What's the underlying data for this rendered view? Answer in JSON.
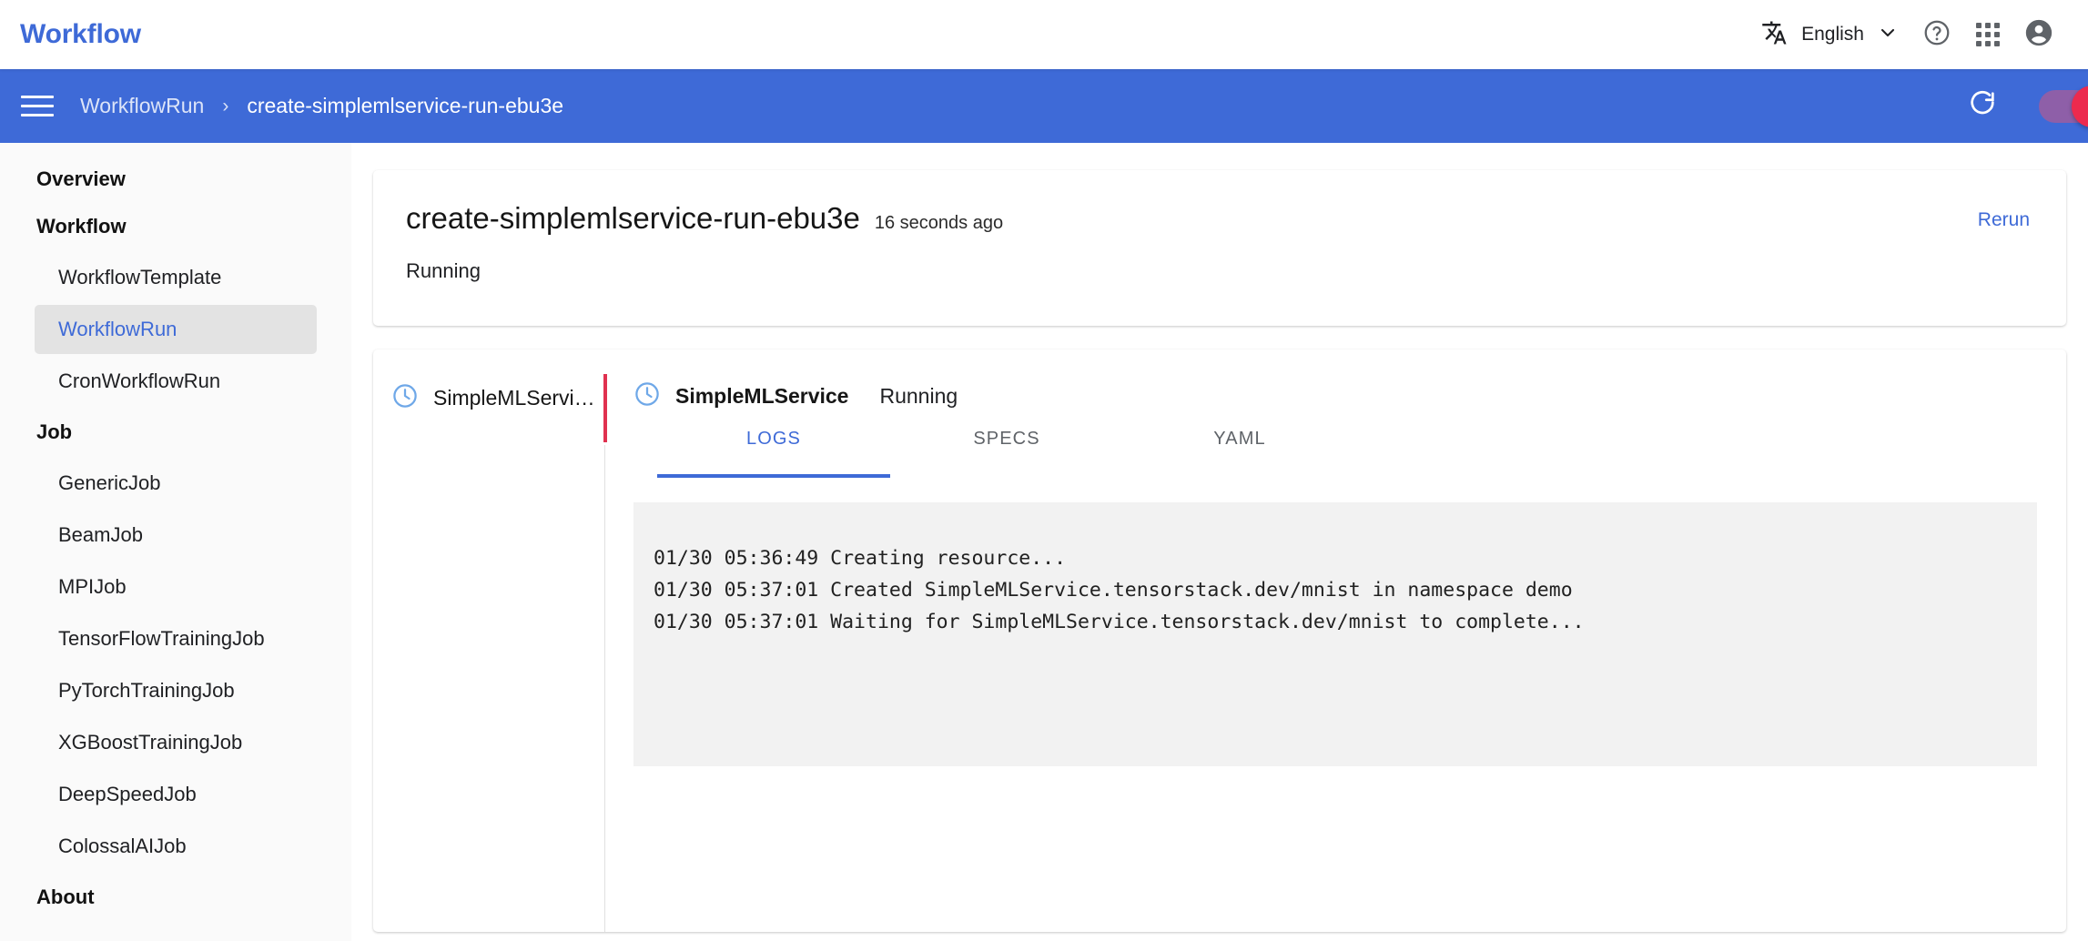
{
  "header": {
    "brand": "Workflow",
    "language": "English",
    "icons": {
      "translate": "translate-icon",
      "chevron": "chevron-down-icon",
      "help": "help-circle-icon",
      "apps": "apps-grid-icon",
      "account": "account-circle-icon"
    }
  },
  "appbar": {
    "menu_icon": "hamburger-menu-icon",
    "breadcrumb": {
      "parent": "WorkflowRun",
      "separator": "›",
      "current": "create-simplemlservice-run-ebu3e"
    },
    "refresh_icon": "refresh-icon",
    "auto_refresh_toggle": {
      "state": "on",
      "track_color": "#8E5FA8",
      "thumb_color": "#EC2A4E"
    }
  },
  "sidebar": {
    "items": [
      {
        "label": "Overview",
        "type": "head",
        "active": false
      },
      {
        "label": "Workflow",
        "type": "head",
        "active": false
      },
      {
        "label": "WorkflowTemplate",
        "type": "item",
        "active": false
      },
      {
        "label": "WorkflowRun",
        "type": "item",
        "active": true
      },
      {
        "label": "CronWorkflowRun",
        "type": "item",
        "active": false
      },
      {
        "label": "Job",
        "type": "head",
        "active": false
      },
      {
        "label": "GenericJob",
        "type": "item",
        "active": false
      },
      {
        "label": "BeamJob",
        "type": "item",
        "active": false
      },
      {
        "label": "MPIJob",
        "type": "item",
        "active": false
      },
      {
        "label": "TensorFlowTrainingJob",
        "type": "item",
        "active": false
      },
      {
        "label": "PyTorchTrainingJob",
        "type": "item",
        "active": false
      },
      {
        "label": "XGBoostTrainingJob",
        "type": "item",
        "active": false
      },
      {
        "label": "DeepSpeedJob",
        "type": "item",
        "active": false
      },
      {
        "label": "ColossalAIJob",
        "type": "item",
        "active": false
      },
      {
        "label": "About",
        "type": "head",
        "active": false
      }
    ]
  },
  "summary": {
    "title": "create-simplemlservice-run-ebu3e",
    "age": "16 seconds ago",
    "status": "Running",
    "rerun_label": "Rerun"
  },
  "detail": {
    "node": {
      "icon": "clock-icon",
      "label": "SimpleMLServi…"
    },
    "head": {
      "icon": "clock-icon",
      "name": "SimpleMLService",
      "state": "Running"
    },
    "tabs": [
      {
        "label": "LOGS",
        "active": true
      },
      {
        "label": "SPECS",
        "active": false
      },
      {
        "label": "YAML",
        "active": false
      }
    ],
    "logs": [
      "01/30 05:36:49 Creating resource...",
      "01/30 05:37:01 Created SimpleMLService.tensorstack.dev/mnist in namespace demo",
      "01/30 05:37:01 Waiting for SimpleMLService.tensorstack.dev/mnist to complete..."
    ]
  },
  "colors": {
    "brand_blue": "#3E6AD7",
    "accent_red": "#E0314F",
    "clock_blue": "#6FA8E8",
    "sidebar_bg": "#FAFAFA",
    "log_bg": "#F2F2F2"
  }
}
